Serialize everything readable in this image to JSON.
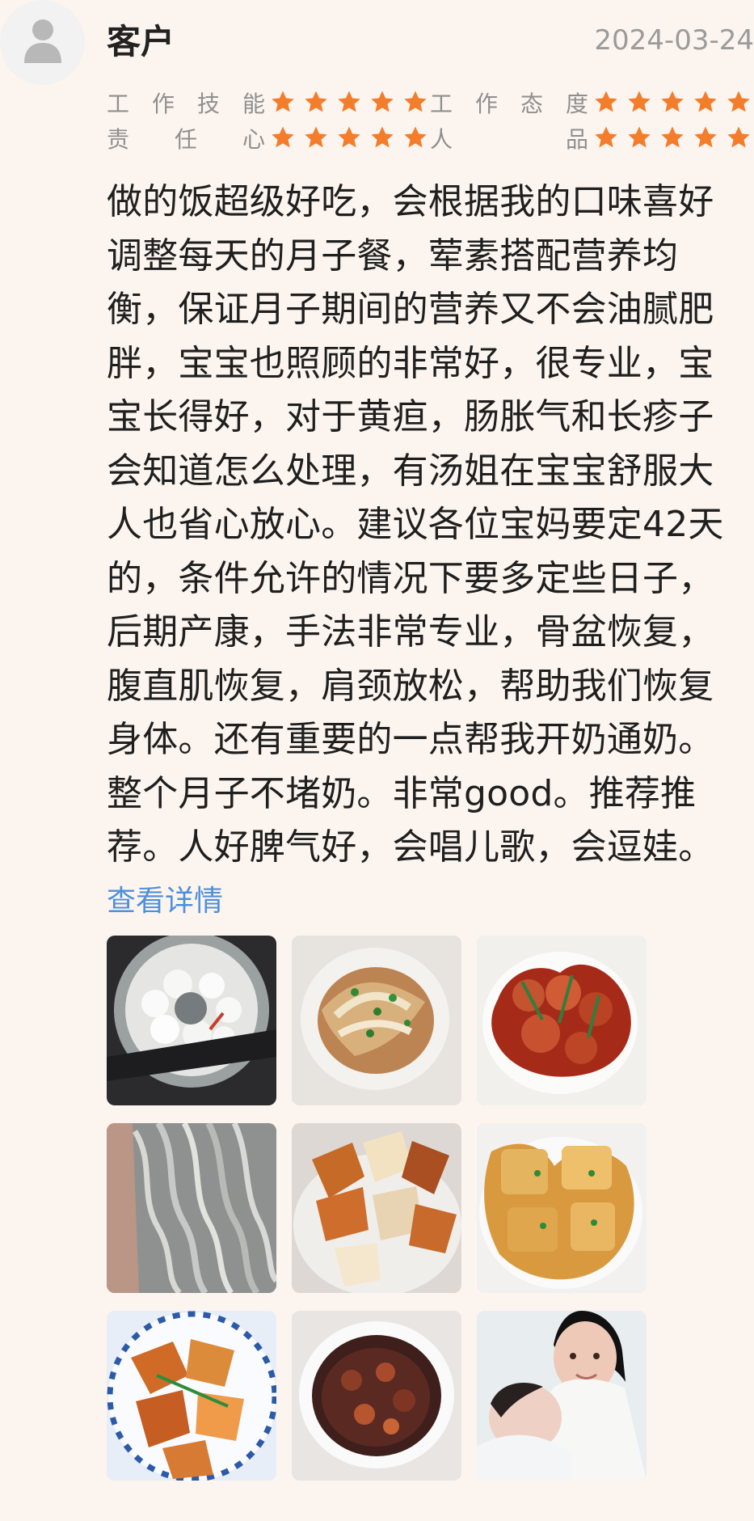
{
  "header": {
    "user_name": "客户",
    "date": "2024-03-24"
  },
  "ratings": [
    {
      "label": "工作技能",
      "stars": 5
    },
    {
      "label": "工作态度",
      "stars": 5
    },
    {
      "label": "责任心",
      "stars": 5
    },
    {
      "label": "人品",
      "stars": 5
    }
  ],
  "review": {
    "text": "做的饭超级好吃，会根据我的口味喜好调整每天的月子餐，荤素搭配营养均衡，保证月子期间的营养又不会油腻肥胖，宝宝也照顾的非常好，很专业，宝宝长得好，对于黄疸，肠胀气和长疹子会知道怎么处理，有汤姐在宝宝舒服大人也省心放心。建议各位宝妈要定42天的，条件允许的情况下要多定些日子，后期产康，手法非常专业，骨盆恢复，腹直肌恢复，肩颈放松，帮助我们恢复身体。还有重要的一点帮我开奶通奶。整个月子不堵奶。非常good。推荐推荐。人好脾气好，会唱儿歌，会逗娃。",
    "detail_link": "查看详情"
  },
  "photos": [
    {
      "name": "steamed-buns-photo"
    },
    {
      "name": "noodle-vegetable-photo"
    },
    {
      "name": "braised-meat-photo"
    },
    {
      "name": "noodles-photo"
    },
    {
      "name": "potatoes-photo"
    },
    {
      "name": "tofu-dish-photo"
    },
    {
      "name": "fried-tofu-photo"
    },
    {
      "name": "soup-photo"
    },
    {
      "name": "mother-baby-photo"
    }
  ],
  "colors": {
    "background": "#fcf5ef",
    "star": "#f47d2c",
    "link": "#4f8fdb",
    "muted": "#8f8f8f"
  },
  "icons": {
    "avatar": "user-silhouette-icon",
    "rating": "star-icon"
  }
}
